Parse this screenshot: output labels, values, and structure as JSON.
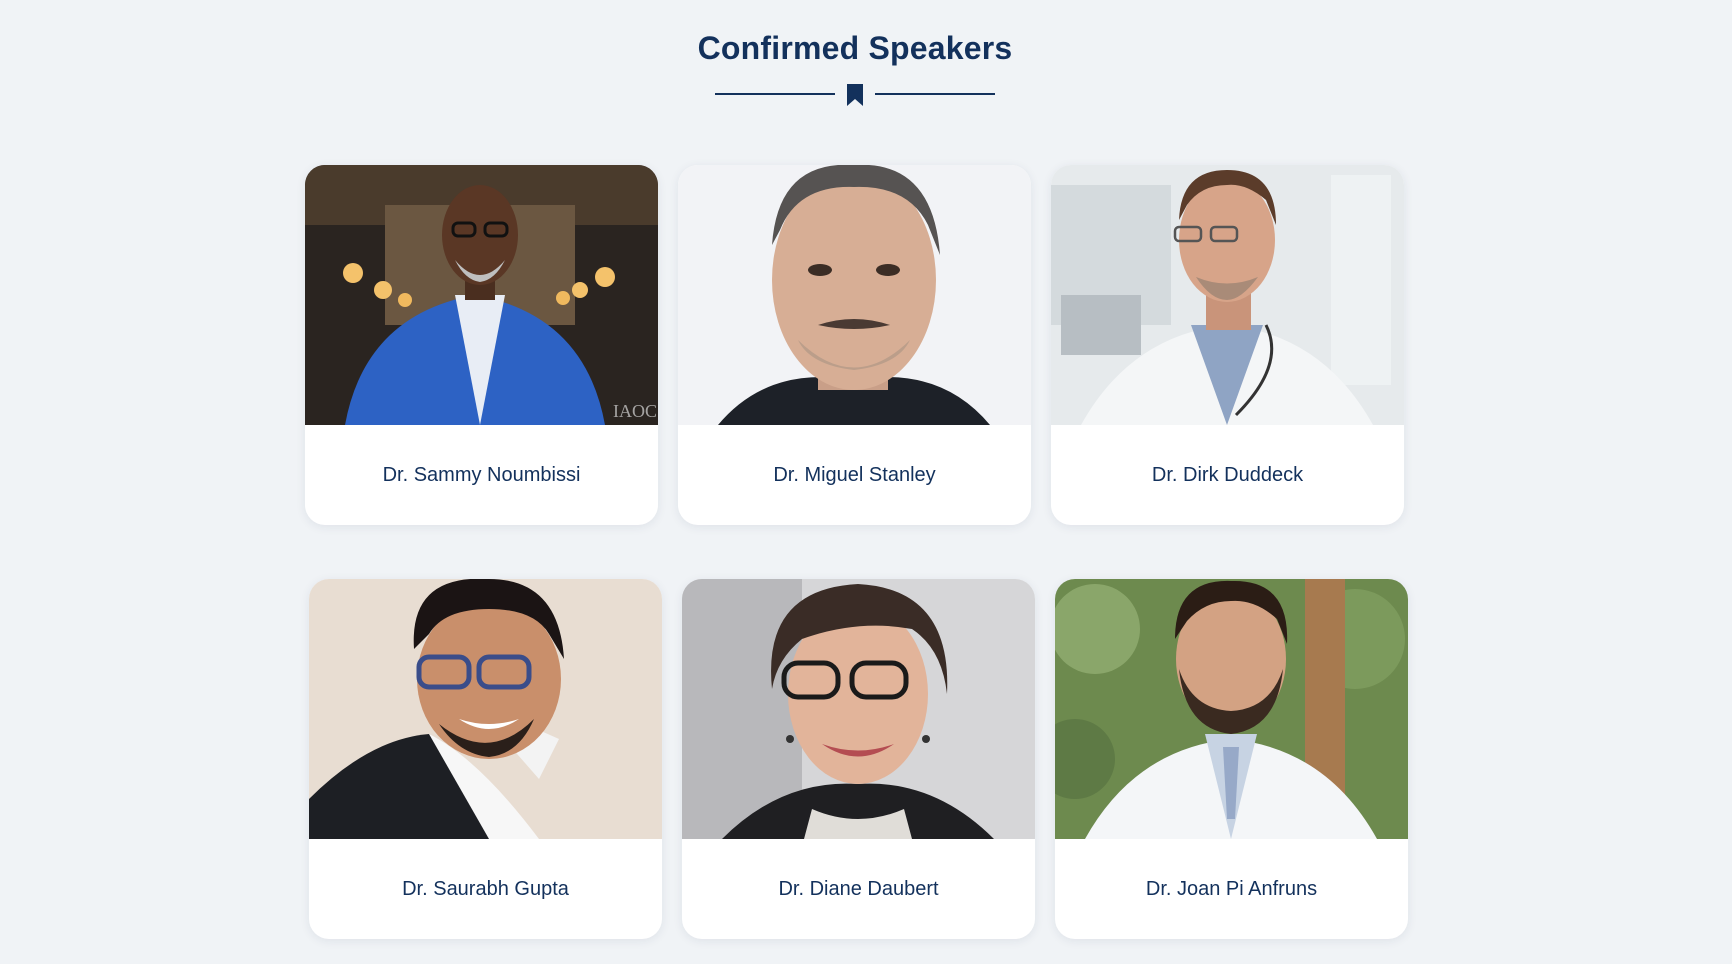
{
  "section": {
    "title": "Confirmed Speakers"
  },
  "icons": {
    "divider": "bookmark-icon"
  },
  "colors": {
    "accent": "#13315c",
    "background": "#f0f3f6",
    "card": "#ffffff"
  },
  "speakers": [
    {
      "name": "Dr. Sammy Noumbissi",
      "photo_watermark": "IAOC"
    },
    {
      "name": "Dr. Miguel Stanley"
    },
    {
      "name": "Dr. Dirk Duddeck"
    },
    {
      "name": "Dr. Saurabh Gupta"
    },
    {
      "name": "Dr. Diane Daubert"
    },
    {
      "name": "Dr. Joan Pi Anfruns"
    }
  ]
}
